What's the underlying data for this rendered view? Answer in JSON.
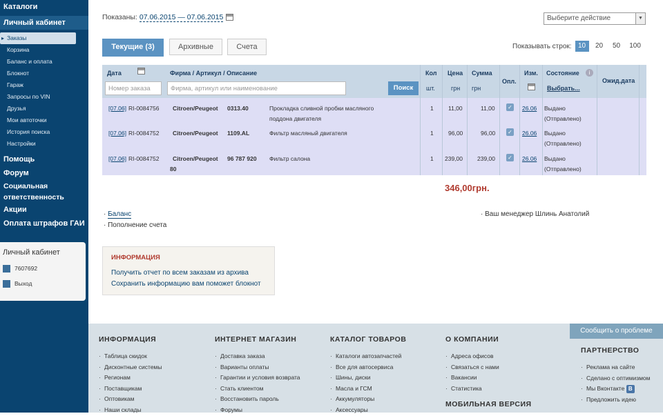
{
  "sidebar": {
    "top_items": [
      "Каталоги",
      "Личный кабинет"
    ],
    "sub_items": [
      "Заказы",
      "Корзина",
      "Баланс и оплата",
      "Блокнот",
      "Гараж",
      "Запросы по VIN",
      "Друзья",
      "Мои автоточки",
      "История поиска",
      "Настройки"
    ],
    "bottom_items": [
      "Помощь",
      "Форум",
      "Социальная",
      "ответственность",
      "Акции",
      "Оплата штрафов ГАИ"
    ],
    "account": {
      "title": "Личный кабинет",
      "user_id": "7607692",
      "logout": "Выход"
    }
  },
  "main": {
    "shown_label": "Показаны:",
    "date_range": "07.06.2015 — 07.06.2015",
    "action_placeholder": "Выберите действие",
    "tabs": [
      "Текущие (3)",
      "Архивные",
      "Счета"
    ],
    "rows_per_label": "Показывать строк:",
    "rows_options": [
      "10",
      "20",
      "50",
      "100"
    ],
    "table": {
      "h_date": "Дата",
      "h_firm": "Фирма / Артикул / Описание",
      "h_qty": "Кол",
      "h_qty_unit": "шт.",
      "h_price": "Цена",
      "h_price_unit": "грн",
      "h_sum": "Сумма",
      "h_sum_unit": "грн",
      "h_paid": "Опл.",
      "h_changed": "Изм.",
      "h_state": "Состояние",
      "h_choose": "Выбрать...",
      "h_expected": "Ожид.дата",
      "order_placeholder": "Номер заказа",
      "search_placeholder": "Фирма, артикул или наименование",
      "search_btn": "Поиск",
      "rows": [
        {
          "date": "[07.06]",
          "order": "RI-0084756",
          "brand": "Citroen/Peugeot",
          "article": "0313.40",
          "desc1": "Прокладка сливной пробки масляного",
          "desc2": "поддона двигателя",
          "qty": "1",
          "price": "11,00",
          "sum": "11,00",
          "changed": "26.06",
          "state1": "Выдано",
          "state2": "(Отправлено)",
          "art2": ""
        },
        {
          "date": "[07.06]",
          "order": "RI-0084752",
          "brand": "Citroen/Peugeot",
          "article": "1109.AL",
          "desc1": "Фильтр масляный двигателя",
          "desc2": "",
          "qty": "1",
          "price": "96,00",
          "sum": "96,00",
          "changed": "26.06",
          "state1": "Выдано",
          "state2": "(Отправлено)",
          "art2": ""
        },
        {
          "date": "[07.06]",
          "order": "RI-0084752",
          "brand": "Citroen/Peugeot",
          "article": "96 787 920",
          "desc1": "Фильтр салона",
          "desc2": "",
          "qty": "1",
          "price": "239,00",
          "sum": "239,00",
          "changed": "26.06",
          "state1": "Выдано",
          "state2": "(Отправлено)",
          "art2": "80"
        }
      ]
    },
    "total": "346,00грн.",
    "balance": "Баланс",
    "topup": "Пополнение счета",
    "manager": "Ваш менеджер Шлинь Анатолий",
    "info": {
      "title": "ИНФОРМАЦИЯ",
      "line1": "Получить отчет по всем заказам из архива",
      "line2": "Сохранить информацию вам поможет блокнот"
    }
  },
  "footer": {
    "report": "Сообщить о проблеме",
    "cols": [
      {
        "title": "ИНФОРМАЦИЯ",
        "items": [
          "Таблица скидок",
          "Дисконтные системы",
          "Регионам",
          "Поставщикам",
          "Оптовикам",
          "Наши склады"
        ]
      },
      {
        "title": "ИНТЕРНЕТ МАГАЗИН",
        "items": [
          "Доставка заказа",
          "Варианты оплаты",
          "Гарантии и условия возврата",
          "Стать клиентом",
          "Восстановить пароль",
          "Форумы"
        ]
      },
      {
        "title": "КАТАЛОГ ТОВАРОВ",
        "items": [
          "Каталоги автозапчастей",
          "Все для автосервиса",
          "Шины, диски",
          "Масла и ГСМ",
          "Аккумуляторы",
          "Аксессуары"
        ]
      },
      {
        "title": "О КОМПАНИИ",
        "items": [
          "Адреса офисов",
          "Связаться с нами",
          "Вакансии",
          "Статистика"
        ],
        "extra": "МОБИЛЬНАЯ ВЕРСИЯ"
      },
      {
        "title": "ПАРТНЕРСТВО",
        "items": [
          "Реклама на сайте",
          "Сделано с оптимизмом",
          "Мы Вконтакте",
          "Предложить идею"
        ]
      }
    ]
  }
}
